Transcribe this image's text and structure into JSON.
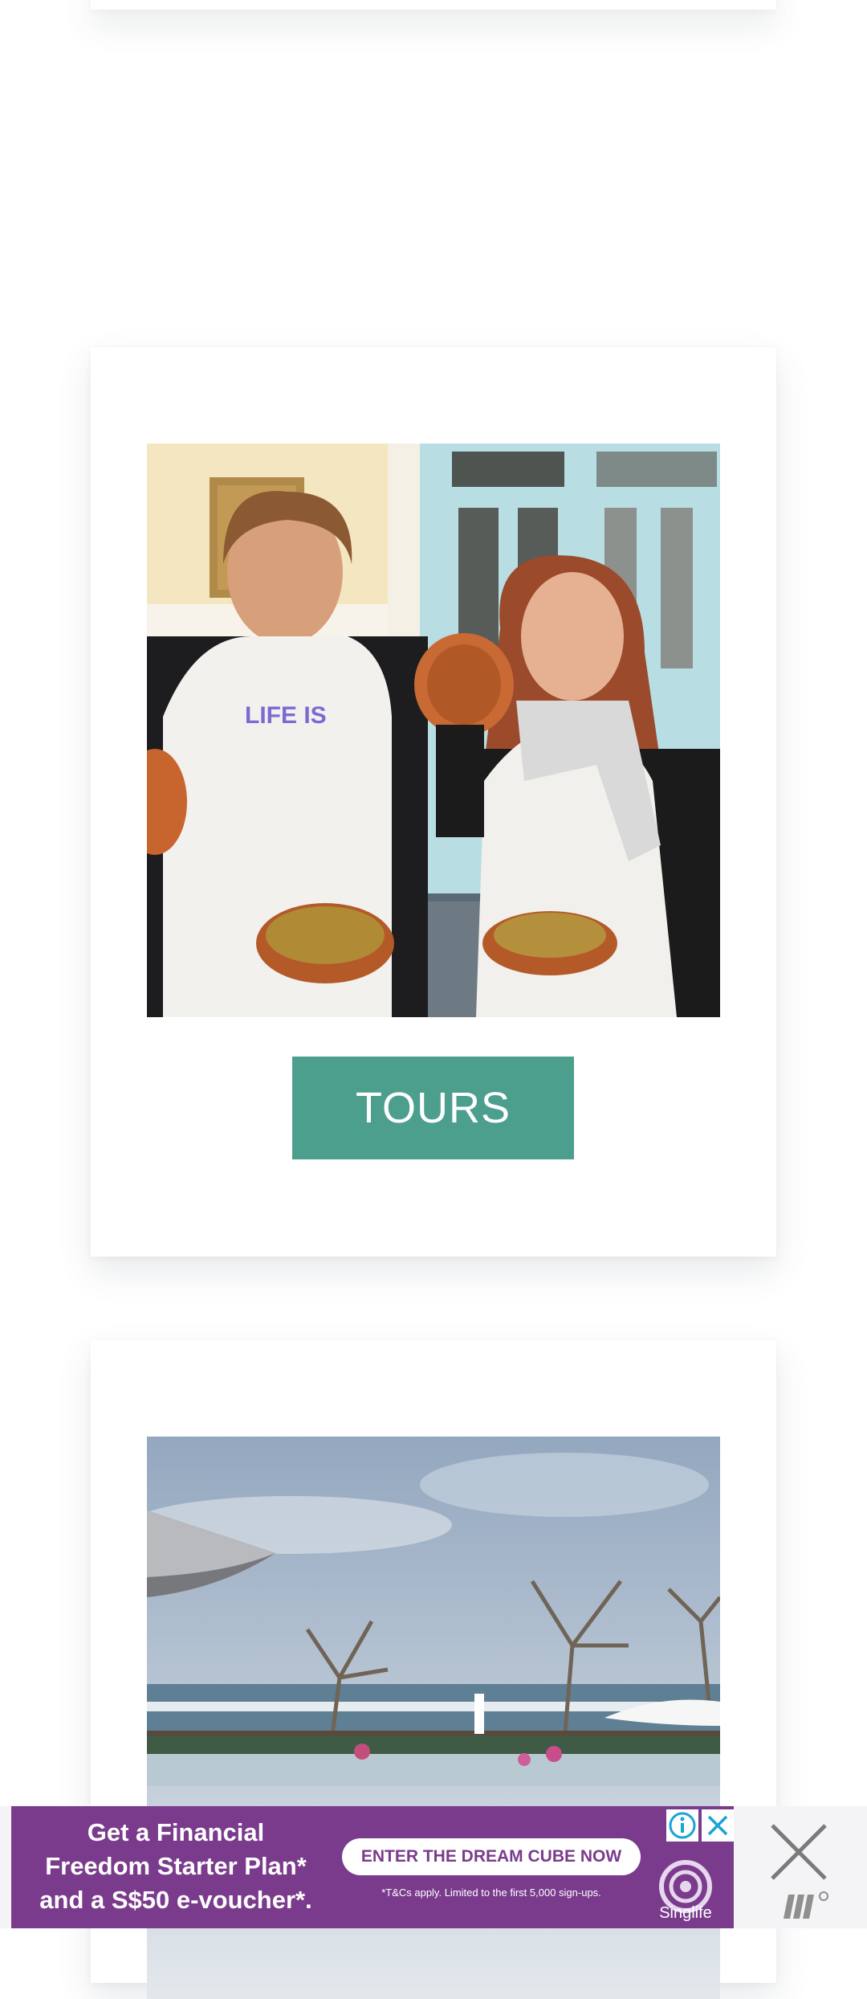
{
  "tours_card": {
    "photo_alt": "Two people in aprons holding tagine dishes",
    "button_label": "TOURS"
  },
  "next_card": {
    "photo_alt": "Seaside terrace with umbrellas and trees"
  },
  "ad": {
    "headline_line1": "Get a Financial",
    "headline_line2": "Freedom Starter Plan*",
    "headline_line3": "and a S$50 e-voucher*.",
    "cta_label": "ENTER THE DREAM CUBE NOW",
    "fine_print": "*T&Cs apply. Limited to the first 5,000 sign-ups.",
    "brand": "Singlife",
    "colors": {
      "background": "#7a3b8c",
      "cta_text": "#7a3b8c"
    }
  },
  "colors": {
    "tours_button": "#4d9f8d"
  },
  "icons": {
    "close": "close-icon",
    "info": "info-icon",
    "ad_close": "ad-close-icon",
    "network": "ad-network-logo-icon"
  }
}
